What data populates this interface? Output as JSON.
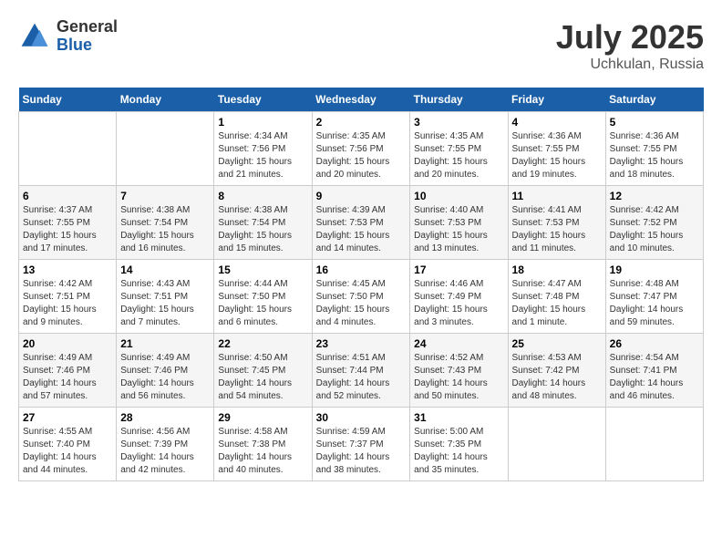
{
  "header": {
    "logo_general": "General",
    "logo_blue": "Blue",
    "month_title": "July 2025",
    "location": "Uchkulan, Russia"
  },
  "weekdays": [
    "Sunday",
    "Monday",
    "Tuesday",
    "Wednesday",
    "Thursday",
    "Friday",
    "Saturday"
  ],
  "weeks": [
    [
      {
        "day": "",
        "info": ""
      },
      {
        "day": "",
        "info": ""
      },
      {
        "day": "1",
        "info": "Sunrise: 4:34 AM\nSunset: 7:56 PM\nDaylight: 15 hours and 21 minutes."
      },
      {
        "day": "2",
        "info": "Sunrise: 4:35 AM\nSunset: 7:56 PM\nDaylight: 15 hours and 20 minutes."
      },
      {
        "day": "3",
        "info": "Sunrise: 4:35 AM\nSunset: 7:55 PM\nDaylight: 15 hours and 20 minutes."
      },
      {
        "day": "4",
        "info": "Sunrise: 4:36 AM\nSunset: 7:55 PM\nDaylight: 15 hours and 19 minutes."
      },
      {
        "day": "5",
        "info": "Sunrise: 4:36 AM\nSunset: 7:55 PM\nDaylight: 15 hours and 18 minutes."
      }
    ],
    [
      {
        "day": "6",
        "info": "Sunrise: 4:37 AM\nSunset: 7:55 PM\nDaylight: 15 hours and 17 minutes."
      },
      {
        "day": "7",
        "info": "Sunrise: 4:38 AM\nSunset: 7:54 PM\nDaylight: 15 hours and 16 minutes."
      },
      {
        "day": "8",
        "info": "Sunrise: 4:38 AM\nSunset: 7:54 PM\nDaylight: 15 hours and 15 minutes."
      },
      {
        "day": "9",
        "info": "Sunrise: 4:39 AM\nSunset: 7:53 PM\nDaylight: 15 hours and 14 minutes."
      },
      {
        "day": "10",
        "info": "Sunrise: 4:40 AM\nSunset: 7:53 PM\nDaylight: 15 hours and 13 minutes."
      },
      {
        "day": "11",
        "info": "Sunrise: 4:41 AM\nSunset: 7:53 PM\nDaylight: 15 hours and 11 minutes."
      },
      {
        "day": "12",
        "info": "Sunrise: 4:42 AM\nSunset: 7:52 PM\nDaylight: 15 hours and 10 minutes."
      }
    ],
    [
      {
        "day": "13",
        "info": "Sunrise: 4:42 AM\nSunset: 7:51 PM\nDaylight: 15 hours and 9 minutes."
      },
      {
        "day": "14",
        "info": "Sunrise: 4:43 AM\nSunset: 7:51 PM\nDaylight: 15 hours and 7 minutes."
      },
      {
        "day": "15",
        "info": "Sunrise: 4:44 AM\nSunset: 7:50 PM\nDaylight: 15 hours and 6 minutes."
      },
      {
        "day": "16",
        "info": "Sunrise: 4:45 AM\nSunset: 7:50 PM\nDaylight: 15 hours and 4 minutes."
      },
      {
        "day": "17",
        "info": "Sunrise: 4:46 AM\nSunset: 7:49 PM\nDaylight: 15 hours and 3 minutes."
      },
      {
        "day": "18",
        "info": "Sunrise: 4:47 AM\nSunset: 7:48 PM\nDaylight: 15 hours and 1 minute."
      },
      {
        "day": "19",
        "info": "Sunrise: 4:48 AM\nSunset: 7:47 PM\nDaylight: 14 hours and 59 minutes."
      }
    ],
    [
      {
        "day": "20",
        "info": "Sunrise: 4:49 AM\nSunset: 7:46 PM\nDaylight: 14 hours and 57 minutes."
      },
      {
        "day": "21",
        "info": "Sunrise: 4:49 AM\nSunset: 7:46 PM\nDaylight: 14 hours and 56 minutes."
      },
      {
        "day": "22",
        "info": "Sunrise: 4:50 AM\nSunset: 7:45 PM\nDaylight: 14 hours and 54 minutes."
      },
      {
        "day": "23",
        "info": "Sunrise: 4:51 AM\nSunset: 7:44 PM\nDaylight: 14 hours and 52 minutes."
      },
      {
        "day": "24",
        "info": "Sunrise: 4:52 AM\nSunset: 7:43 PM\nDaylight: 14 hours and 50 minutes."
      },
      {
        "day": "25",
        "info": "Sunrise: 4:53 AM\nSunset: 7:42 PM\nDaylight: 14 hours and 48 minutes."
      },
      {
        "day": "26",
        "info": "Sunrise: 4:54 AM\nSunset: 7:41 PM\nDaylight: 14 hours and 46 minutes."
      }
    ],
    [
      {
        "day": "27",
        "info": "Sunrise: 4:55 AM\nSunset: 7:40 PM\nDaylight: 14 hours and 44 minutes."
      },
      {
        "day": "28",
        "info": "Sunrise: 4:56 AM\nSunset: 7:39 PM\nDaylight: 14 hours and 42 minutes."
      },
      {
        "day": "29",
        "info": "Sunrise: 4:58 AM\nSunset: 7:38 PM\nDaylight: 14 hours and 40 minutes."
      },
      {
        "day": "30",
        "info": "Sunrise: 4:59 AM\nSunset: 7:37 PM\nDaylight: 14 hours and 38 minutes."
      },
      {
        "day": "31",
        "info": "Sunrise: 5:00 AM\nSunset: 7:35 PM\nDaylight: 14 hours and 35 minutes."
      },
      {
        "day": "",
        "info": ""
      },
      {
        "day": "",
        "info": ""
      }
    ]
  ]
}
